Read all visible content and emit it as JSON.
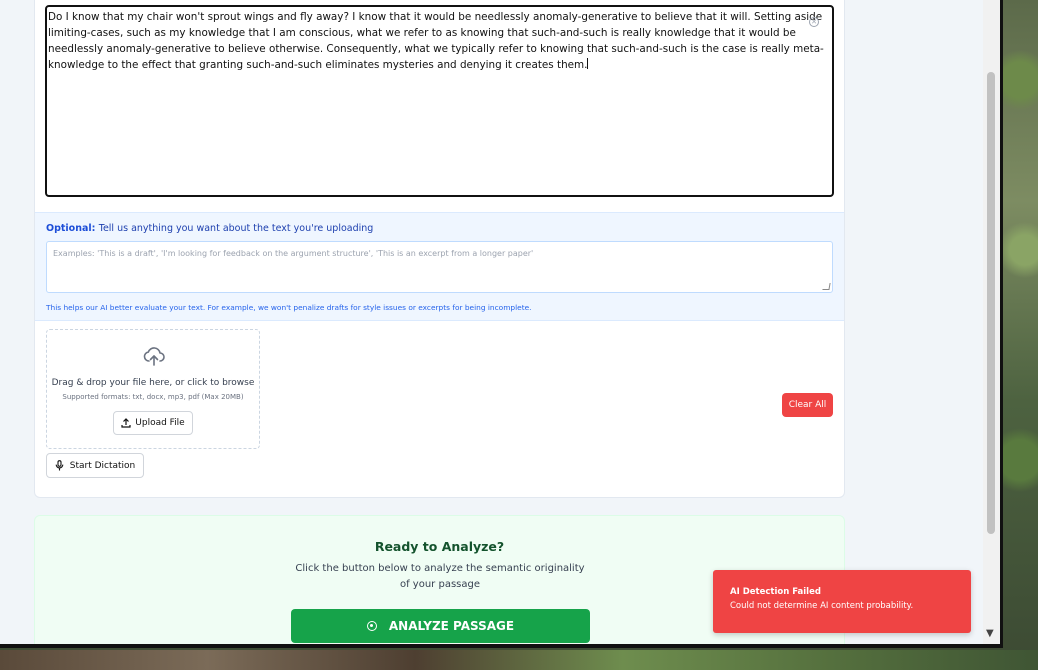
{
  "editor": {
    "text": "Do I know that my chair won't sprout wings and fly away? I know that it would be needlessly anomaly-generative to believe that it will. Setting aside limiting-cases, such as my knowledge that I am conscious, what we refer to as knowing that such-and-such is really knowledge that it would be needlessly anomaly-generative to believe otherwise. Consequently, what we typically refer to knowing that such-and-such is the case is really meta-knowledge to the effect that granting such-and-such eliminates mysteries and denying it creates them."
  },
  "notes": {
    "label_bold": "Optional:",
    "label_rest": "Tell us anything you want about the text you're uploading",
    "placeholder": "Examples: 'This is a draft', 'I'm looking for feedback on the argument structure', 'This is an excerpt from a longer paper'",
    "help": "This helps our AI better evaluate your text. For example, we won't penalize drafts for style issues or excerpts for being incomplete."
  },
  "upload": {
    "title": "Drag & drop your file here, or click to browse",
    "formats": "Supported formats: txt, docx, mp3, pdf (Max 20MB)",
    "button_label": "Upload File"
  },
  "dictation": {
    "label": "Start Dictation"
  },
  "clear_all": {
    "label": "Clear All"
  },
  "analyze": {
    "title": "Ready to Analyze?",
    "description": "Click the button below to analyze the semantic originality of your passage",
    "button_label": "ANALYZE PASSAGE"
  },
  "toast": {
    "title": "AI Detection Failed",
    "message": "Could not determine AI content probability."
  },
  "colors": {
    "accent_green": "#16a34a",
    "danger_red": "#ef4444",
    "info_blue": "#2563eb"
  }
}
